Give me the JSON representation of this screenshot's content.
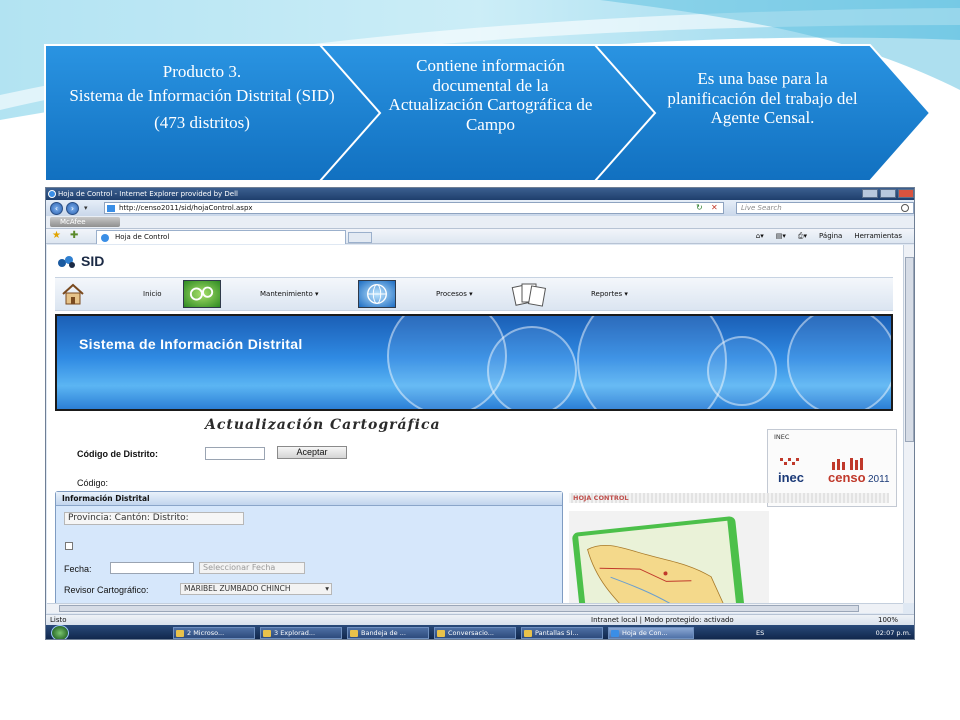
{
  "slide": {
    "chevron1": {
      "line1": "Producto 3.",
      "line2": "Sistema de Información Distrital (SID)",
      "line3": "(473 distritos)"
    },
    "chevron2": {
      "text": "Contiene información documental de la Actualización Cartográfica de Campo"
    },
    "chevron3": {
      "text": "Es una base para la planificación del trabajo del Agente Censal."
    },
    "colors": {
      "chevron": "#1b7fd1",
      "swoosh": "#8fd3ea"
    }
  },
  "browser": {
    "title": "Hoja de Control - Internet Explorer provided by Dell",
    "url": "http://censo2011/sid/hojaControl.aspx",
    "search_placeholder": "Live Search",
    "toolbar_brand": "McAfee",
    "tab_label": "Hoja de Control",
    "commands": {
      "page": "Página",
      "tools": "Herramientas"
    },
    "status": {
      "left": "Listo",
      "zone": "Intranet local | Modo protegido: activado",
      "zoom": "100%"
    }
  },
  "app": {
    "logo_text": "SID",
    "menu": [
      {
        "label": "Inicio",
        "icon": "home-icon"
      },
      {
        "label": "Mantenimiento",
        "icon": "gears-icon"
      },
      {
        "label": "Procesos",
        "icon": "globe-icon"
      },
      {
        "label": "Reportes",
        "icon": "documents-icon"
      }
    ],
    "banner_title": "Sistema de Información Distrital",
    "section_title": "Actualización Cartográfica",
    "codigo_distrito_label": "Código de Distrito:",
    "aceptar_button": "Aceptar",
    "codigo_label": "Código:",
    "info_panel": {
      "header": "Información Distrital",
      "location_label": "Provincia: Cantón: Distrito:",
      "fecha_label": "Fecha:",
      "seleccionar_fecha_button": "Seleccionar Fecha",
      "revisor_label": "Revisor Cartográfico:",
      "revisor_value": "MARIBEL ZUMBADO CHINCH"
    },
    "inec": {
      "label": "INEC",
      "logo_word1": "inec",
      "logo_word2": "censo",
      "logo_year": "2011"
    },
    "hoja_control_label": "HOJA CONTROL"
  },
  "taskbar": {
    "items": [
      {
        "label": "2 Microso...",
        "active": false
      },
      {
        "label": "3 Explorad...",
        "active": false
      },
      {
        "label": "Bandeja de ...",
        "active": false
      },
      {
        "label": "Conversacio...",
        "active": false
      },
      {
        "label": "Pantallas SI...",
        "active": false
      },
      {
        "label": "Hoja de Con...",
        "active": true
      }
    ],
    "lang": "ES",
    "clock": "02:07 p.m."
  }
}
